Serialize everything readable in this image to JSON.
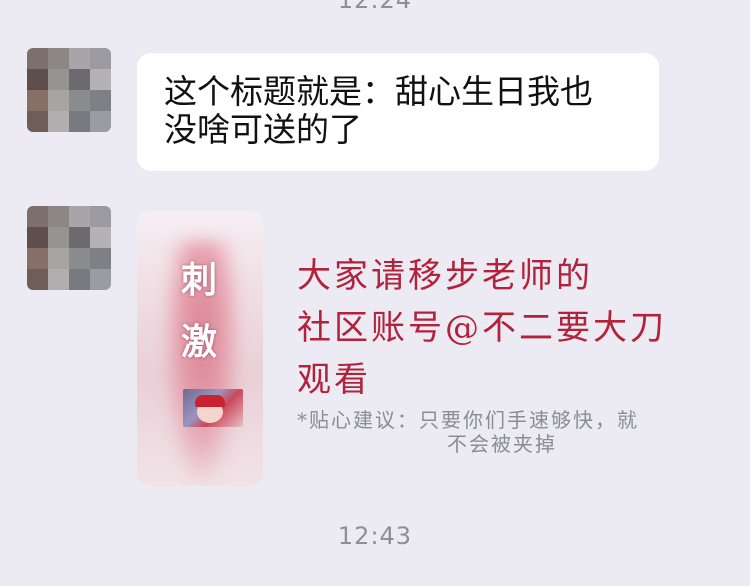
{
  "chat": {
    "timestamp_top": "12:24",
    "timestamp_bottom": "12:43",
    "message_text_line1": "这个标题就是：甜心生日我也",
    "message_text_line2": "没啥可送的了",
    "image_title_chars": [
      "刺",
      "激"
    ]
  },
  "annotation": {
    "line1": "大家请移步老师的",
    "line2": "社区账号@不二要大刀",
    "line3": "观看",
    "color": "#b3213a"
  },
  "tip": {
    "line1": "*贴心建议：只要你们手速够快，就",
    "line2": "不会被夹掉"
  },
  "avatar_icon": "pixelated-avatar"
}
